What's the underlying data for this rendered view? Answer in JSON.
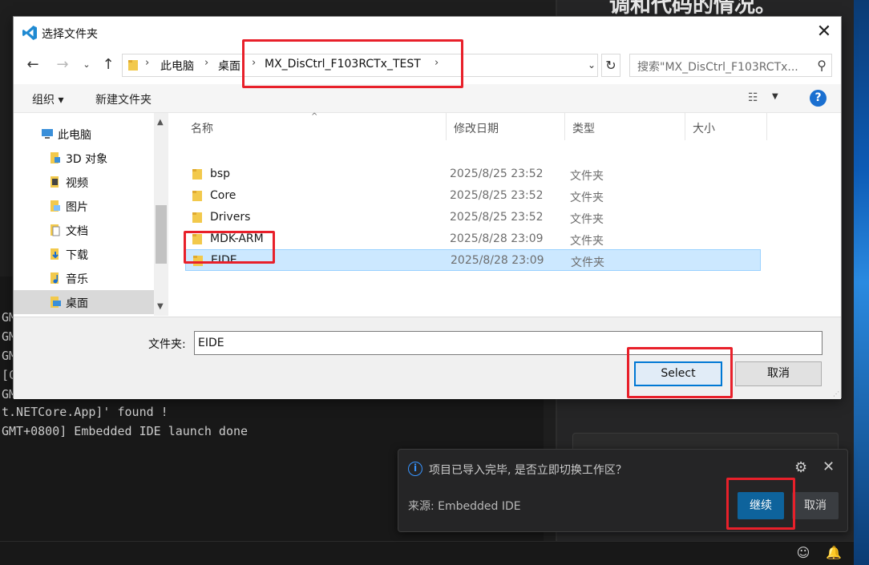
{
  "background": {
    "right_title": "调和代码的情况。",
    "terminal_lines": [
      "GM",
      "GM",
      "GM",
      "[C",
      "GM",
      "t.NETCore.App]' found !",
      "GMT+0800] Embedded IDE launch done"
    ]
  },
  "dialog": {
    "title": "选择文件夹",
    "address_segments": [
      "此电脑",
      "桌面",
      "MX_DisCtrl_F103RCTx_TEST"
    ],
    "search_placeholder": "搜索\"MX_DisCtrl_F103RCTx...",
    "toolbar": {
      "organize": "组织 ▾",
      "new_folder": "新建文件夹"
    },
    "tree": [
      {
        "label": "此电脑",
        "icon": "computer-icon"
      },
      {
        "label": "3D 对象",
        "icon": "3d-objects-icon"
      },
      {
        "label": "视频",
        "icon": "video-icon"
      },
      {
        "label": "图片",
        "icon": "pictures-icon"
      },
      {
        "label": "文档",
        "icon": "documents-icon"
      },
      {
        "label": "下载",
        "icon": "download-icon"
      },
      {
        "label": "音乐",
        "icon": "music-icon"
      },
      {
        "label": "桌面",
        "icon": "desktop-icon"
      }
    ],
    "columns": {
      "name": "名称",
      "date": "修改日期",
      "type": "类型",
      "size": "大小"
    },
    "files": [
      {
        "name": "bsp",
        "date": "2025/8/25 23:52",
        "type": "文件夹"
      },
      {
        "name": "Core",
        "date": "2025/8/25 23:52",
        "type": "文件夹"
      },
      {
        "name": "Drivers",
        "date": "2025/8/25 23:52",
        "type": "文件夹"
      },
      {
        "name": "MDK-ARM",
        "date": "2025/8/28 23:09",
        "type": "文件夹"
      },
      {
        "name": "EIDE",
        "date": "2025/8/28 23:09",
        "type": "文件夹"
      }
    ],
    "folder_label": "文件夹:",
    "folder_value": "EIDE",
    "select_label": "Select",
    "cancel_label": "取消"
  },
  "notification": {
    "message": "项目已导入完毕, 是否立即切换工作区？",
    "source": "来源: Embedded IDE",
    "continue_label": "继续",
    "cancel_label": "取消"
  },
  "colors": {
    "highlight": "#e8202a",
    "accent": "#0078d4",
    "vscode_button": "#0e639c",
    "selection": "#cce8ff"
  }
}
